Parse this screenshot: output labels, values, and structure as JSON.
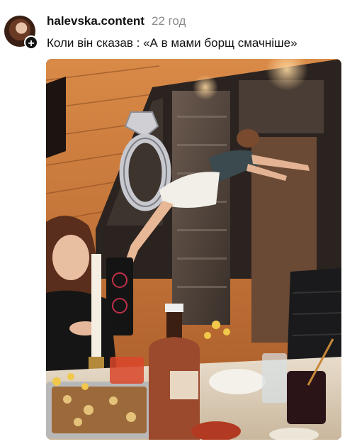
{
  "post": {
    "username": "halevska.content",
    "time_ago": "22 год",
    "caption": "Коли він сказав : «А в мами борщ смачніше»",
    "follow_symbol": "+"
  },
  "media": {
    "kind": "photo",
    "scene": "woman-leaping-over-dinner-table"
  },
  "colors": {
    "text": "#111111",
    "muted": "#8a8a8a",
    "wood": "#c9773a",
    "wall_dark": "#2b2320"
  }
}
